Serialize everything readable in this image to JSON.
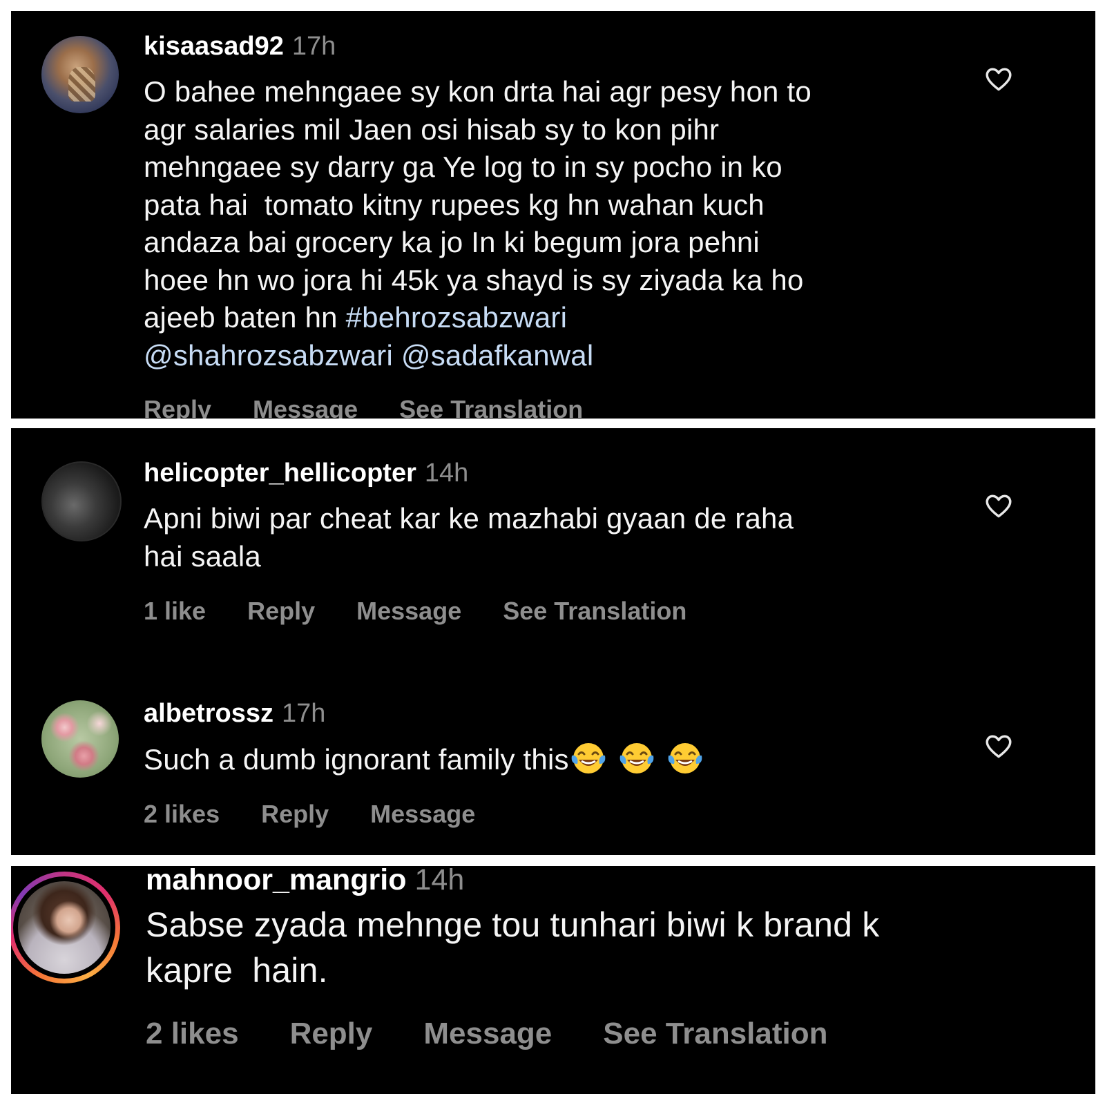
{
  "comments": [
    {
      "username": "kisaasad92",
      "time": "17h",
      "text_lines": [
        "O bahee mehngaee sy kon drta hai agr pesy hon to",
        "agr salaries mil Jaen osi hisab sy to kon pihr",
        "mehngaee sy darry ga Ye log to in sy pocho in ko",
        "pata hai  tomato kitny rupees kg hn wahan kuch",
        "andaza bai grocery ka jo In ki begum jora pehni",
        "hoee hn wo jora hi 45k ya shayd is sy ziyada ka ho"
      ],
      "text_last_prefix": "ajeeb baten hn ",
      "hashtag": "#behrozsabzwari",
      "mention_1": "@shahrozsabzwari",
      "mention_2": "@sadafkanwal",
      "actions": {
        "reply": "Reply",
        "message": "Message",
        "translate": "See Translation"
      },
      "heart_icon": "heart-outline-icon"
    },
    {
      "username": "helicopter_hellicopter",
      "time": "14h",
      "text_lines": [
        "Apni biwi par cheat kar ke mazhabi gyaan de raha",
        "hai saala"
      ],
      "actions": {
        "likes": "1 like",
        "reply": "Reply",
        "message": "Message",
        "translate": "See Translation"
      },
      "heart_icon": "heart-outline-icon"
    },
    {
      "username": "albetrossz",
      "time": "17h",
      "text": "Such a dumb ignorant family this",
      "emoji": [
        "face-with-tears-of-joy-icon",
        "face-with-tears-of-joy-icon",
        "face-with-tears-of-joy-icon"
      ],
      "actions": {
        "likes": "2 likes",
        "reply": "Reply",
        "message": "Message"
      },
      "heart_icon": "heart-outline-icon"
    },
    {
      "username": "mahnoor_mangrio",
      "time": "14h",
      "text_lines": [
        "Sabse zyada mehnge tou tunhari biwi k brand k",
        "kapre  hain."
      ],
      "actions": {
        "likes": "2 likes",
        "reply": "Reply",
        "message": "Message",
        "translate": "See Translation"
      }
    }
  ],
  "colors": {
    "background": "#000000",
    "separator": "#ffffff",
    "username": "#ffffff",
    "secondary": "#8e8e8e",
    "link": "#c7dcf5",
    "story_ring": [
      "#833ab4",
      "#e1306c",
      "#f77737",
      "#fcaf45"
    ]
  }
}
